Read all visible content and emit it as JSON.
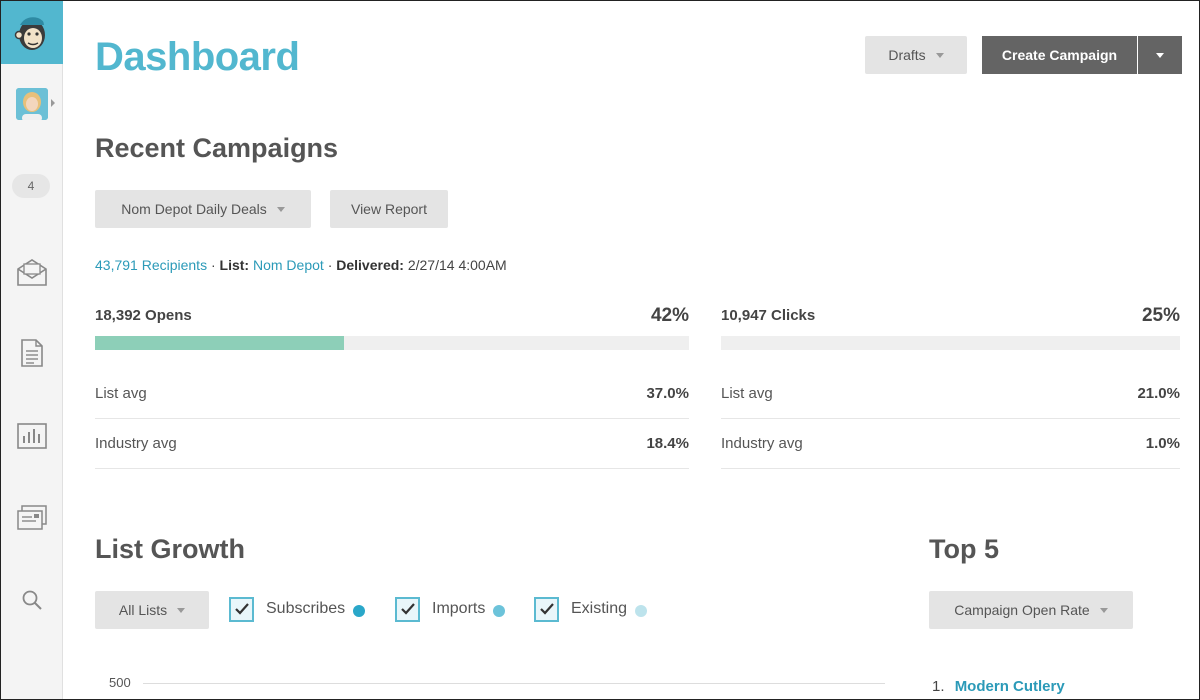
{
  "sidebar": {
    "logo": "mailchimp-logo",
    "notification_count": "4",
    "icons": [
      "campaigns-icon",
      "templates-icon",
      "reports-icon",
      "lists-icon",
      "search-icon"
    ]
  },
  "header": {
    "title": "Dashboard",
    "drafts_label": "Drafts",
    "create_label": "Create Campaign"
  },
  "recent": {
    "title": "Recent Campaigns",
    "campaign_select": "Nom Depot Daily Deals",
    "view_report_label": "View Report",
    "recipients": "43,791 Recipients",
    "list_prefix": "List:",
    "list_name": "Nom Depot",
    "delivered_prefix": "Delivered:",
    "delivered_value": "2/27/14 4:00AM",
    "opens": {
      "label": "18,392 Opens",
      "percent": "42%",
      "rate": 0.42,
      "list_avg_label": "List avg",
      "list_avg": "37.0%",
      "industry_avg_label": "Industry avg",
      "industry_avg": "18.4%"
    },
    "clicks": {
      "label": "10,947 Clicks",
      "percent": "25%",
      "rate": 0,
      "list_avg_label": "List avg",
      "list_avg": "21.0%",
      "industry_avg_label": "Industry avg",
      "industry_avg": "1.0%"
    }
  },
  "list_growth": {
    "title": "List Growth",
    "list_select": "All Lists",
    "legend": [
      {
        "label": "Subscribes",
        "color": "#2aa7c9"
      },
      {
        "label": "Imports",
        "color": "#6cc3da"
      },
      {
        "label": "Existing",
        "color": "#bde3ec"
      }
    ],
    "y_tick": "500"
  },
  "top5": {
    "title": "Top 5",
    "metric_select": "Campaign Open Rate",
    "items": [
      {
        "rank": "1.",
        "name": "Modern Cutlery"
      }
    ]
  },
  "colors": {
    "brand": "#52b7cf",
    "link": "#2b9ab8",
    "opens_bar": "#8dcfb8"
  }
}
